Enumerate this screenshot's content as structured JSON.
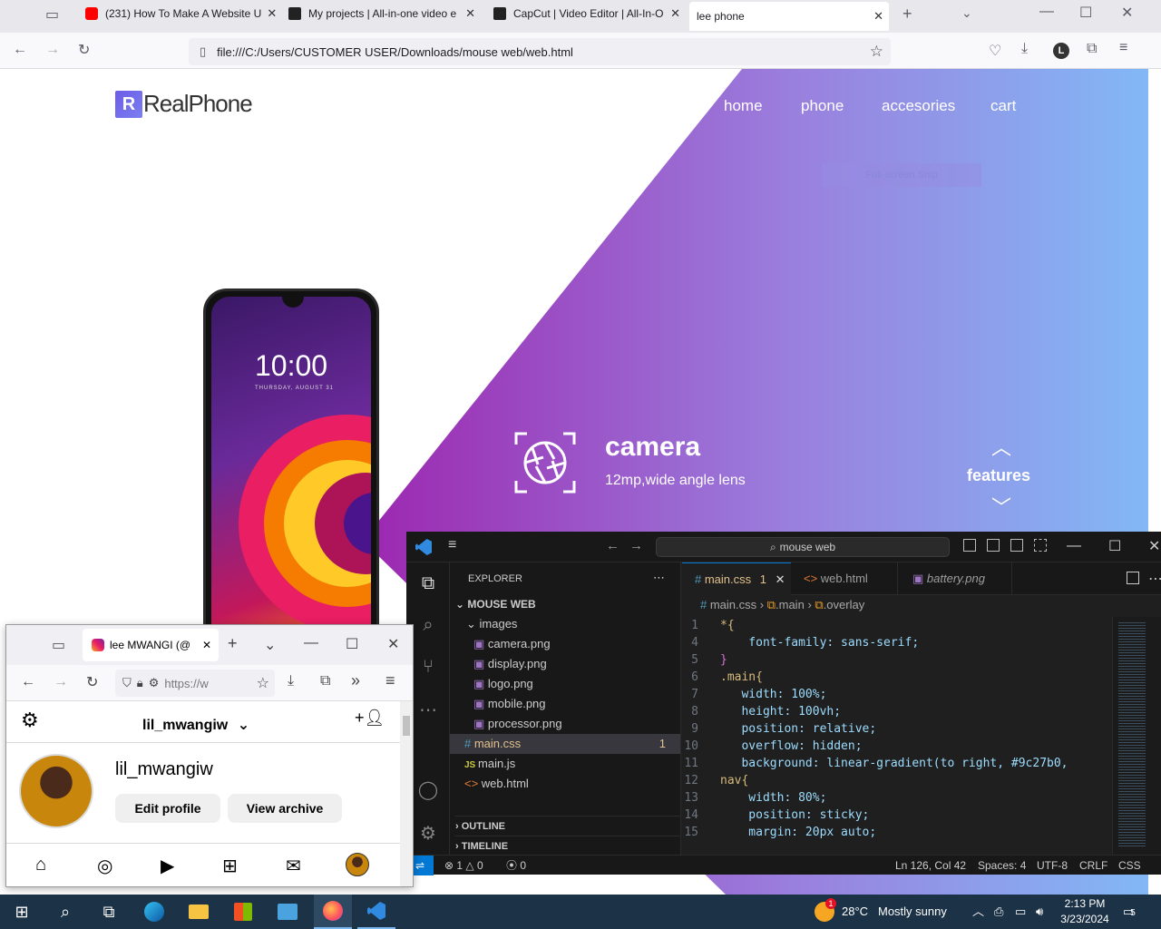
{
  "browser": {
    "tabs": [
      {
        "title": "(231) How To Make A Website U",
        "icon": "youtube-icon"
      },
      {
        "title": "My projects | All-in-one video e",
        "icon": "capcut-icon"
      },
      {
        "title": "CapCut | Video Editor | All-In-O",
        "icon": "capcut-icon"
      },
      {
        "title": "lee phone",
        "icon": ""
      }
    ],
    "url": "file:///C:/Users/CUSTOMER USER/Downloads/mouse web/web.html",
    "profile_letter": "L"
  },
  "page": {
    "logo_mark": "R",
    "logo_text": "RealPhone",
    "nav": [
      "home",
      "phone",
      "accesories",
      "cart"
    ],
    "snip_label": "Full-screen Snip",
    "phone_time": "10:00",
    "phone_date": "THURSDAY, AUGUST 31",
    "feature_title": "camera",
    "feature_desc": "12mp,wide angle lens",
    "features_label": "features",
    "colors": {
      "gradient_left": "#9c27b0",
      "gradient_right": "#82b8f5"
    }
  },
  "vscode": {
    "search": "mouse web",
    "explorer_title": "EXPLORER",
    "folder": "MOUSE WEB",
    "subfolder": "images",
    "images": [
      "camera.png",
      "display.png",
      "logo.png",
      "mobile.png",
      "processor.png"
    ],
    "files": [
      {
        "name": "main.css",
        "badge": "1",
        "kind": "css"
      },
      {
        "name": "main.js",
        "badge": "",
        "kind": "js"
      },
      {
        "name": "web.html",
        "badge": "",
        "kind": "html"
      }
    ],
    "outline": "OUTLINE",
    "timeline": "TIMELINE",
    "tabs": [
      {
        "name": "main.css",
        "badge": "1"
      },
      {
        "name": "web.html",
        "badge": ""
      },
      {
        "name": "battery.png",
        "badge": ""
      }
    ],
    "breadcrumb": [
      "main.css",
      ".main",
      ".overlay"
    ],
    "code": [
      {
        "n": "1",
        "text": "*{"
      },
      {
        "n": "4",
        "text": "    font-family: sans-serif;"
      },
      {
        "n": "5",
        "text": "}"
      },
      {
        "n": "6",
        "text": ".main{"
      },
      {
        "n": "7",
        "text": "   width: 100%;"
      },
      {
        "n": "8",
        "text": "   height: 100vh;"
      },
      {
        "n": "9",
        "text": "   position: relative;"
      },
      {
        "n": "10",
        "text": "   overflow: hidden;"
      },
      {
        "n": "11",
        "text": "   background: linear-gradient(to right, #9c27b0,"
      },
      {
        "n": "12",
        "text": "nav{"
      },
      {
        "n": "13",
        "text": "    width: 80%;"
      },
      {
        "n": "14",
        "text": "    position: sticky;"
      },
      {
        "n": "15",
        "text": "    margin: 20px auto;"
      }
    ],
    "status": {
      "errors": "1",
      "warnings": "0",
      "ports": "0",
      "position": "Ln 126, Col 42",
      "spaces": "Spaces: 4",
      "encoding": "UTF-8",
      "eol": "CRLF",
      "language": "CSS"
    }
  },
  "mini_browser": {
    "tab_title": "lee MWANGI (@",
    "url": "https://w",
    "username": "lil_mwangiw",
    "display_name": "lil_mwangiw",
    "edit_profile": "Edit profile",
    "view_archive": "View archive"
  },
  "taskbar": {
    "weather_temp": "28°C",
    "weather_text": "Mostly sunny",
    "weather_badge": "1",
    "time": "2:13 PM",
    "date": "3/23/2024",
    "notifications": "5"
  }
}
